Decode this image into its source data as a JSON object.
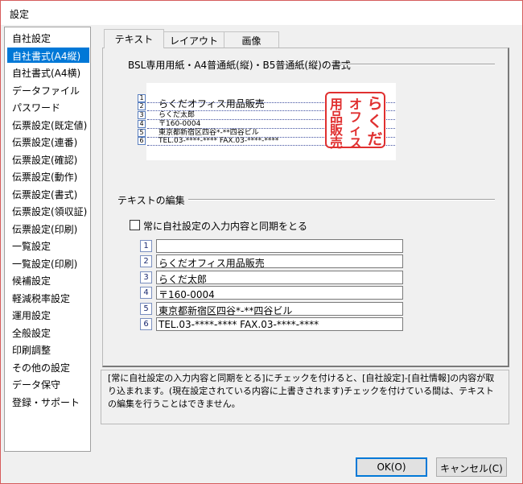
{
  "window": {
    "title": "設定"
  },
  "nav": {
    "items": [
      "自社設定",
      "自社書式(A4縦)",
      "自社書式(A4横)",
      "データファイル",
      "パスワード",
      "伝票設定(既定値)",
      "伝票設定(連番)",
      "伝票設定(確認)",
      "伝票設定(動作)",
      "伝票設定(書式)",
      "伝票設定(領収証)",
      "伝票設定(印刷)",
      "一覧設定",
      "一覧設定(印刷)",
      "候補設定",
      "軽減税率設定",
      "運用設定",
      "全般設定",
      "印刷調整",
      "その他の設定",
      "データ保守",
      "登録・サポート"
    ],
    "selected_index": 1
  },
  "tabs": [
    {
      "label": "テキスト"
    },
    {
      "label": "レイアウト"
    },
    {
      "label": "画像"
    }
  ],
  "preview_section": {
    "title": "BSL専用用紙・A4普通紙(縦)・B5普通紙(縦)の書式",
    "lines": [
      {
        "num": "1",
        "text": ""
      },
      {
        "num": "2",
        "text": "らくだオフィス用品販売"
      },
      {
        "num": "3",
        "text": "らくだ太郎"
      },
      {
        "num": "4",
        "text": "〒160-0004"
      },
      {
        "num": "5",
        "text": "東京都新宿区四谷*-**四谷ビル"
      },
      {
        "num": "6",
        "text": "TEL.03-****-****   FAX.03-****-****"
      }
    ],
    "stamp": {
      "col1": "用品販売",
      "col2": "オフィス",
      "col3": "らくだ"
    }
  },
  "edit_section": {
    "title": "テキストの編集",
    "sync_checkbox_label": "常に自社設定の入力内容と同期をとる",
    "sync_checked": false,
    "rows": [
      {
        "num": "1",
        "value": ""
      },
      {
        "num": "2",
        "value": "らくだオフィス用品販売"
      },
      {
        "num": "3",
        "value": "らくだ太郎"
      },
      {
        "num": "4",
        "value": "〒160-0004"
      },
      {
        "num": "5",
        "value": "東京都新宿区四谷*-**四谷ビル"
      },
      {
        "num": "6",
        "value": "TEL.03-****-****   FAX.03-****-****"
      }
    ]
  },
  "info_text": "[常に自社設定の入力内容と同期をとる]にチェックを付けると、[自社設定]-[自社情報]の内容が取り込まれます。(現在設定されている内容に上書きされます)チェックを付けている間は、テキストの編集を行うことはできません。",
  "buttons": {
    "ok": "OK(O)",
    "cancel": "キャンセル(C)"
  }
}
